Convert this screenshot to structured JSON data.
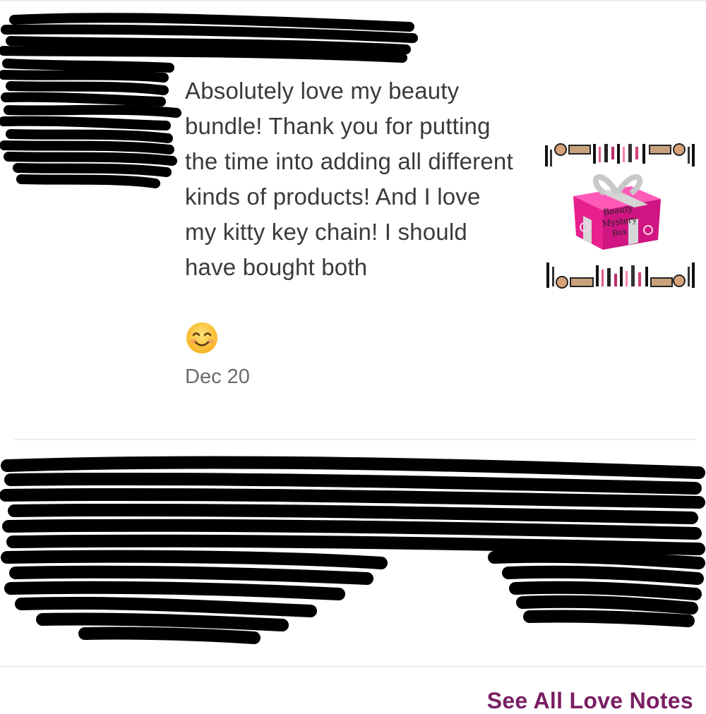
{
  "review": {
    "text": "Absolutely love my beauty bundle! Thank you for putting the time into adding all different kinds of products! And I love my kitty key chain! I should have bought both",
    "emoji": "smiling-face-with-smiling-eyes",
    "date": "Dec 20"
  },
  "product_image": {
    "label_line1": "Beauty",
    "label_line2": "Mystery",
    "label_line3": "Box",
    "box_color": "#e8208e",
    "ribbon_color": "#c8c8c8"
  },
  "footer": {
    "see_all_label": "See All Love Notes",
    "link_color": "#7a1e63"
  }
}
